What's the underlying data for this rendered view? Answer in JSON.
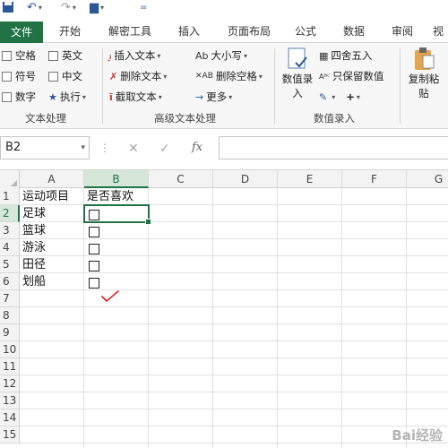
{
  "quick_access": {
    "save_icon": "save-icon",
    "undo_icon": "undo-icon",
    "redo_icon": "redo-icon",
    "customize_icon": "customize-icon"
  },
  "tabs": [
    "文件",
    "开始",
    "解密工具",
    "插入",
    "页面布局",
    "公式",
    "数据",
    "审阅",
    "视"
  ],
  "active_tab": "文件",
  "ribbon": {
    "text_group": {
      "label": "文本处理",
      "checkboxes": [
        "空格",
        "英文",
        "符号",
        "中文",
        "数字"
      ],
      "exec": "执行"
    },
    "advanced_group": {
      "label": "高级文本处理",
      "items": [
        "插入文本",
        "删除文本",
        "截取文本",
        "大小写",
        "删除空格",
        "更多"
      ]
    },
    "value_group": {
      "label": "数值录入",
      "big_button_line1": "数值录",
      "big_button_line2": "入",
      "round": "四舍五入",
      "keep": "只保留数值"
    },
    "copy_button_line1": "复制粘",
    "copy_button_line2": "贴"
  },
  "formula_bar": {
    "name_box": "B2",
    "fx": "fx",
    "formula": ""
  },
  "grid": {
    "columns": [
      "A",
      "B",
      "C",
      "D",
      "E",
      "F",
      "G"
    ],
    "selected_column": "B",
    "rows": [
      "1",
      "2",
      "3",
      "4",
      "5",
      "6",
      "7",
      "8",
      "9",
      "10",
      "11",
      "12",
      "13",
      "14",
      "15"
    ],
    "selected_row": "2",
    "header_a": "运动项目",
    "header_b": "是否喜欢",
    "sports": [
      "足球",
      "篮球",
      "游泳",
      "田径",
      "划船"
    ]
  },
  "colors": {
    "excel_green": "#217346",
    "tick_red": "#e02020"
  },
  "watermark": "Bai经验"
}
